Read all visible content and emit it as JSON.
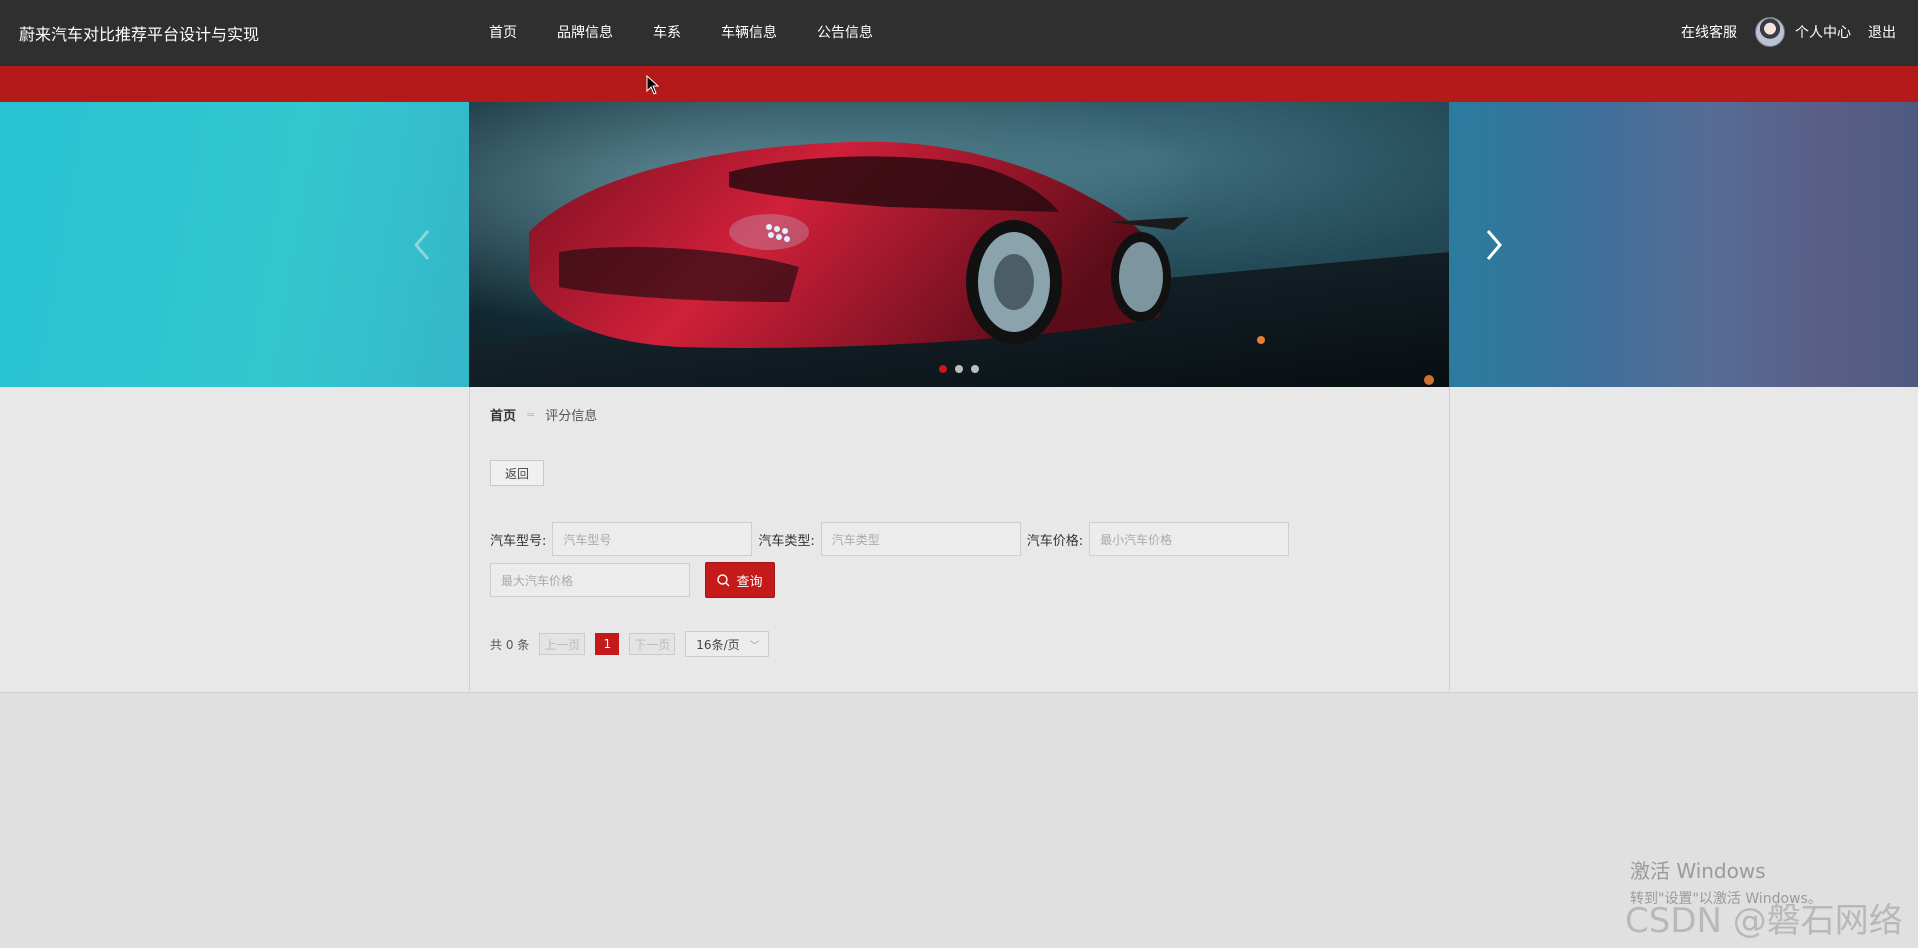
{
  "header": {
    "site_title": "蔚来汽车对比推荐平台设计与实现",
    "nav": [
      "首页",
      "品牌信息",
      "车系",
      "车辆信息",
      "公告信息"
    ],
    "right": {
      "service": "在线客服",
      "center": "个人中心",
      "logout": "退出"
    }
  },
  "banner": {
    "slide_count": 3,
    "active_index": 0
  },
  "breadcrumb": {
    "home": "首页",
    "current": "评分信息"
  },
  "back_label": "返回",
  "filters": {
    "model_label": "汽车型号:",
    "model_placeholder": "汽车型号",
    "type_label": "汽车类型:",
    "type_placeholder": "汽车类型",
    "price_label": "汽车价格:",
    "min_price_placeholder": "最小汽车价格",
    "max_price_placeholder": "最大汽车价格",
    "search_label": "查询"
  },
  "pagination": {
    "total": "共 0 条",
    "prev": "上一页",
    "current": "1",
    "next": "下一页",
    "page_size": "16条/页"
  },
  "watermarks": {
    "windows_title": "激活 Windows",
    "windows_sub": "转到\"设置\"以激活 Windows。",
    "csdn": "CSDN @磐石网络"
  },
  "colors": {
    "accent": "#c41a1a",
    "redbar": "#b41a1a",
    "topbar": "#2f2f2f"
  }
}
